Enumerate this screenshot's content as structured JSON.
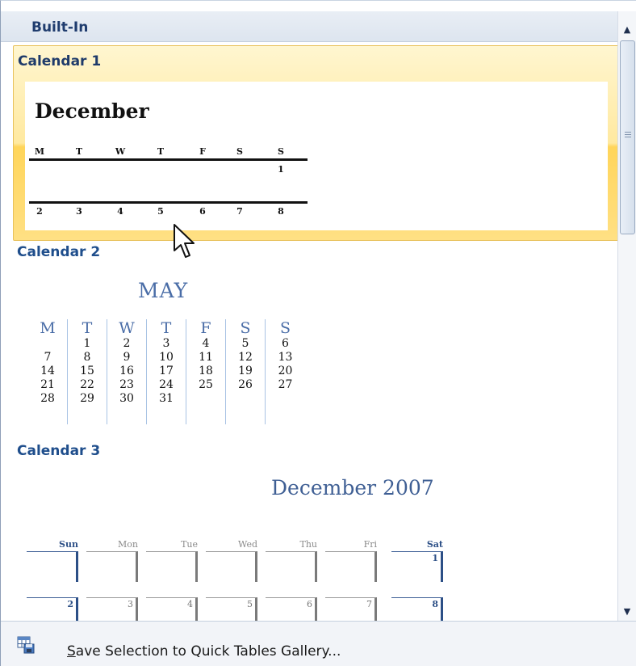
{
  "header": {
    "title": "Built-In"
  },
  "gallery": {
    "calendar1": {
      "title": "Calendar 1",
      "month": "December",
      "weekdays": [
        "M",
        "T",
        "W",
        "T",
        "F",
        "S",
        "S"
      ],
      "week1": [
        "",
        "",
        "",
        "",
        "",
        "",
        "1"
      ],
      "week2": [
        "2",
        "3",
        "4",
        "5",
        "6",
        "7",
        "8"
      ]
    },
    "calendar2": {
      "title": "Calendar 2",
      "month": "MAY",
      "weekdays": [
        "M",
        "T",
        "W",
        "T",
        "F",
        "S",
        "S"
      ],
      "rows": [
        [
          "",
          "1",
          "2",
          "3",
          "4",
          "5",
          "6"
        ],
        [
          "7",
          "8",
          "9",
          "10",
          "11",
          "12",
          "13"
        ],
        [
          "14",
          "15",
          "16",
          "17",
          "18",
          "19",
          "20"
        ],
        [
          "21",
          "22",
          "23",
          "24",
          "25",
          "26",
          "27"
        ],
        [
          "28",
          "29",
          "30",
          "31",
          "",
          "",
          ""
        ]
      ]
    },
    "calendar3": {
      "title": "Calendar 3",
      "month": "December 2007",
      "weekdays": [
        "Sun",
        "Mon",
        "Tue",
        "Wed",
        "Thu",
        "Fri",
        "Sat"
      ],
      "week1": [
        "",
        "",
        "",
        "",
        "",
        "",
        "1"
      ],
      "week2": [
        "2",
        "3",
        "4",
        "5",
        "6",
        "7",
        "8"
      ]
    }
  },
  "footer": {
    "icon": "quick-tables-save-icon",
    "label_accel": "S",
    "label_rest": "ave Selection to Quick Tables Gallery..."
  },
  "scrollbar": {
    "up_glyph": "▲",
    "down_glyph": "▼"
  }
}
